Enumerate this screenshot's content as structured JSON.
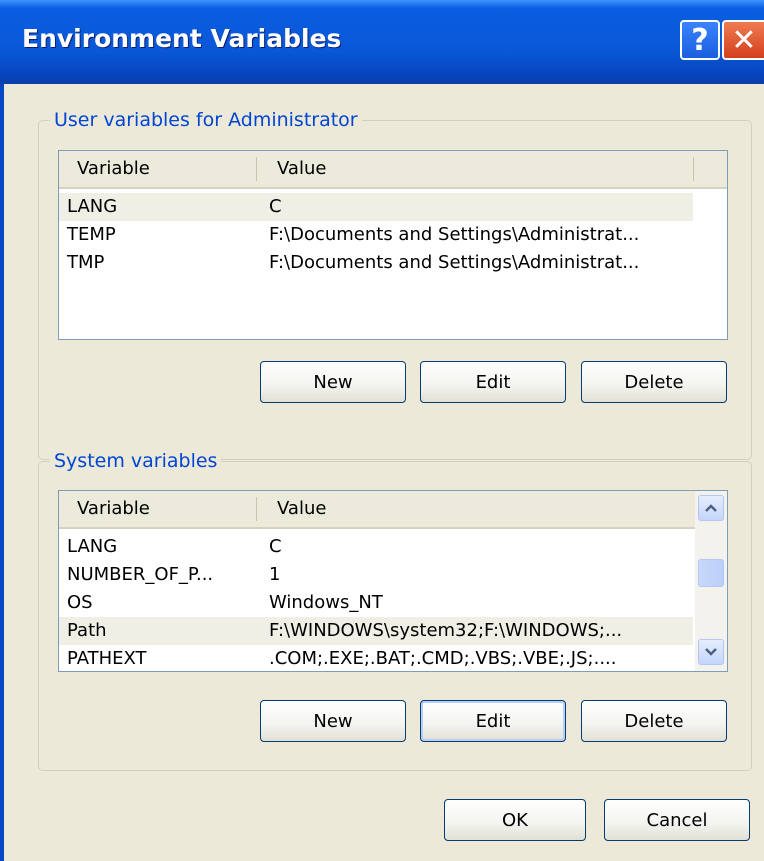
{
  "window": {
    "title": "Environment Variables",
    "help_label": "?",
    "close_label": "✕"
  },
  "user_group": {
    "legend": "User variables for Administrator",
    "columns": [
      "Variable",
      "Value"
    ],
    "rows": [
      {
        "variable": "LANG",
        "value": "C",
        "selected": true
      },
      {
        "variable": "TEMP",
        "value": "F:\\Documents and Settings\\Administrat...",
        "selected": false
      },
      {
        "variable": "TMP",
        "value": "F:\\Documents and Settings\\Administrat...",
        "selected": false
      }
    ],
    "buttons": {
      "new": "New",
      "edit": "Edit",
      "delete": "Delete"
    }
  },
  "system_group": {
    "legend": "System variables",
    "columns": [
      "Variable",
      "Value"
    ],
    "rows": [
      {
        "variable": "LANG",
        "value": "C",
        "selected": false
      },
      {
        "variable": "NUMBER_OF_P...",
        "value": "1",
        "selected": false
      },
      {
        "variable": "OS",
        "value": "Windows_NT",
        "selected": false
      },
      {
        "variable": "Path",
        "value": "F:\\WINDOWS\\system32;F:\\WINDOWS;...",
        "selected": true
      },
      {
        "variable": "PATHEXT",
        "value": ".COM;.EXE;.BAT;.CMD;.VBS;.VBE;.JS;....",
        "selected": false
      }
    ],
    "buttons": {
      "new": "New",
      "edit": "Edit",
      "delete": "Delete"
    },
    "scrollbar": {
      "up_icon": "scroll-up-arrow-icon",
      "down_icon": "scroll-down-arrow-icon"
    }
  },
  "footer": {
    "ok": "OK",
    "cancel": "Cancel"
  },
  "colors": {
    "titlebar": "#0A58D8",
    "legend_text": "#0046D5",
    "dialog_bg": "#ECE9D8",
    "close_button": "#D4401C"
  }
}
